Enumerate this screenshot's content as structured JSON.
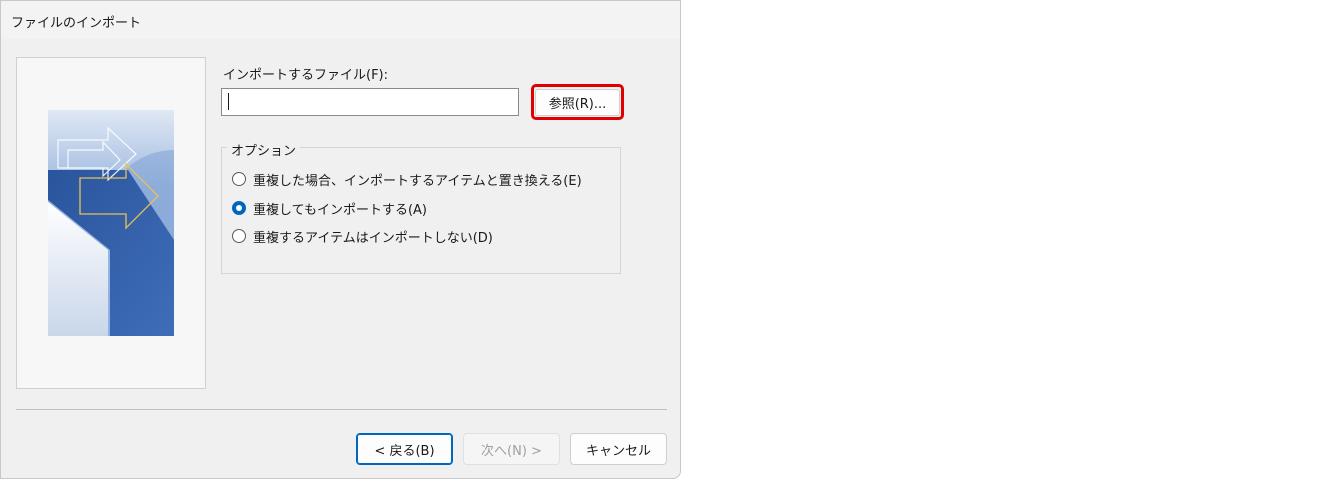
{
  "window": {
    "title": "ファイルのインポート"
  },
  "file_section": {
    "label": "インポートするファイル(F):",
    "input_value": "",
    "browse_label": "参照(R)..."
  },
  "options": {
    "legend": "オプション",
    "items": [
      {
        "label": "重複した場合、インポートするアイテムと置き換える(E)",
        "checked": false
      },
      {
        "label": "重複してもインポートする(A)",
        "checked": true
      },
      {
        "label": "重複するアイテムはインポートしない(D)",
        "checked": false
      }
    ]
  },
  "buttons": {
    "back": "< 戻る(B)",
    "next": "次へ(N) >",
    "cancel": "キャンセル"
  },
  "colors": {
    "accent": "#0067c0",
    "highlight": "#e00000",
    "panel_blue": "#2f5fa8"
  }
}
